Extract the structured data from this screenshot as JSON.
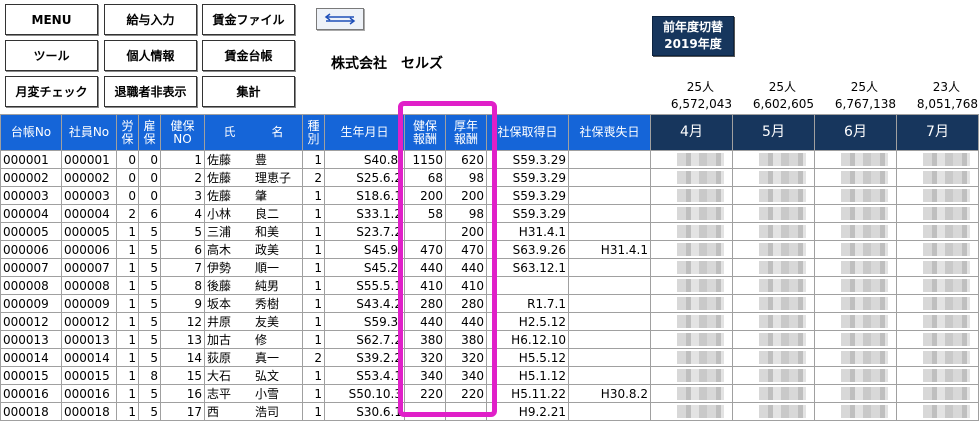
{
  "buttons": {
    "menu": "MENU",
    "salary_input": "給与入力",
    "wage_file": "賃金ファイル",
    "tool": "ツール",
    "personal_info": "個人情報",
    "wage_ledger": "賃金台帳",
    "monthly_check": "月変チェック",
    "hide_retired": "退職者非表示",
    "total": "集計"
  },
  "swap_icon": "swap-arrows-icon",
  "company_name": "株式会社　セルズ",
  "prev_year": {
    "line1": "前年度切替",
    "line2": "2019年度"
  },
  "summary": {
    "counts": [
      "25人",
      "25人",
      "25人",
      "23人"
    ],
    "totals": [
      "6,572,043",
      "6,602,605",
      "6,767,138",
      "8,051,768"
    ]
  },
  "headers": {
    "ledger_no": "台帳No",
    "emp_no": "社員No",
    "labor1": "労",
    "labor2": "保",
    "emp1": "雇",
    "emp2": "保",
    "health1": "健保",
    "health2": "NO",
    "name": "氏　　　名",
    "type1": "種",
    "type2": "別",
    "birth": "生年月日",
    "hrem1": "健保",
    "hrem2": "報酬",
    "prem1": "厚年",
    "prem2": "報酬",
    "acq": "社保取得日",
    "loss": "社保喪失日",
    "months": [
      "4月",
      "5月",
      "6月",
      "7月"
    ]
  },
  "rows": [
    {
      "ledger": "000001",
      "emp": "000001",
      "rou": "0",
      "koyo": "0",
      "kenpo": "1",
      "name": "佐藤　　豊",
      "type": "1",
      "birth": "S40.8.",
      "hrem": "1150",
      "prem": "620",
      "acq": "S59.3.29",
      "loss": ""
    },
    {
      "ledger": "000002",
      "emp": "000002",
      "rou": "0",
      "koyo": "0",
      "kenpo": "2",
      "name": "佐藤　　理恵子",
      "type": "2",
      "birth": "S25.6.2",
      "hrem": "68",
      "prem": "98",
      "acq": "S59.3.29",
      "loss": ""
    },
    {
      "ledger": "000003",
      "emp": "000003",
      "rou": "0",
      "koyo": "0",
      "kenpo": "3",
      "name": "佐藤　　肇",
      "type": "1",
      "birth": "S18.6.1",
      "hrem": "200",
      "prem": "200",
      "acq": "S59.3.29",
      "loss": ""
    },
    {
      "ledger": "000004",
      "emp": "000004",
      "rou": "2",
      "koyo": "6",
      "kenpo": "4",
      "name": "小林　　良二",
      "type": "1",
      "birth": "S33.1.2",
      "hrem": "58",
      "prem": "98",
      "acq": "S59.3.29",
      "loss": ""
    },
    {
      "ledger": "000005",
      "emp": "000005",
      "rou": "1",
      "koyo": "5",
      "kenpo": "5",
      "name": "三浦　　和美",
      "type": "1",
      "birth": "S23.7.2",
      "hrem": "",
      "prem": "200",
      "acq": "H31.4.1",
      "loss": ""
    },
    {
      "ledger": "000006",
      "emp": "000006",
      "rou": "1",
      "koyo": "5",
      "kenpo": "6",
      "name": "高木　　政美",
      "type": "1",
      "birth": "S45.9.",
      "hrem": "470",
      "prem": "470",
      "acq": "S63.9.26",
      "loss": "H31.4.1"
    },
    {
      "ledger": "000007",
      "emp": "000007",
      "rou": "1",
      "koyo": "5",
      "kenpo": "7",
      "name": "伊勢　　順一",
      "type": "1",
      "birth": "S45.2.",
      "hrem": "440",
      "prem": "440",
      "acq": "S63.12.1",
      "loss": ""
    },
    {
      "ledger": "000008",
      "emp": "000008",
      "rou": "1",
      "koyo": "5",
      "kenpo": "8",
      "name": "後藤　　純男",
      "type": "1",
      "birth": "S55.5.1",
      "hrem": "410",
      "prem": "410",
      "acq": "",
      "loss": ""
    },
    {
      "ledger": "000009",
      "emp": "000009",
      "rou": "1",
      "koyo": "5",
      "kenpo": "9",
      "name": "坂本　　秀樹",
      "type": "1",
      "birth": "S43.4.2",
      "hrem": "280",
      "prem": "280",
      "acq": "R1.7.1",
      "loss": ""
    },
    {
      "ledger": "000012",
      "emp": "000012",
      "rou": "1",
      "koyo": "5",
      "kenpo": "12",
      "name": "井原　　友美",
      "type": "1",
      "birth": "S59.3.",
      "hrem": "440",
      "prem": "440",
      "acq": "H2.5.12",
      "loss": ""
    },
    {
      "ledger": "000013",
      "emp": "000013",
      "rou": "1",
      "koyo": "5",
      "kenpo": "13",
      "name": "加古　　修",
      "type": "1",
      "birth": "S62.7.2",
      "hrem": "380",
      "prem": "380",
      "acq": "H6.12.10",
      "loss": ""
    },
    {
      "ledger": "000014",
      "emp": "000014",
      "rou": "1",
      "koyo": "5",
      "kenpo": "14",
      "name": "荻原　　真一",
      "type": "2",
      "birth": "S39.2.2",
      "hrem": "320",
      "prem": "320",
      "acq": "H5.5.12",
      "loss": ""
    },
    {
      "ledger": "000015",
      "emp": "000015",
      "rou": "1",
      "koyo": "8",
      "kenpo": "15",
      "name": "大石　　弘文",
      "type": "1",
      "birth": "S53.4.1",
      "hrem": "340",
      "prem": "340",
      "acq": "H5.1.12",
      "loss": ""
    },
    {
      "ledger": "000016",
      "emp": "000016",
      "rou": "1",
      "koyo": "5",
      "kenpo": "16",
      "name": "志平　　小雪",
      "type": "1",
      "birth": "S50.10.3",
      "hrem": "220",
      "prem": "220",
      "acq": "H5.11.22",
      "loss": "H30.8.2"
    },
    {
      "ledger": "000018",
      "emp": "000018",
      "rou": "1",
      "koyo": "5",
      "kenpo": "17",
      "name": "西　　　浩司",
      "type": "1",
      "birth": "S30.6.1",
      "hrem": "",
      "prem": "",
      "acq": "H9.2.21",
      "loss": ""
    }
  ]
}
